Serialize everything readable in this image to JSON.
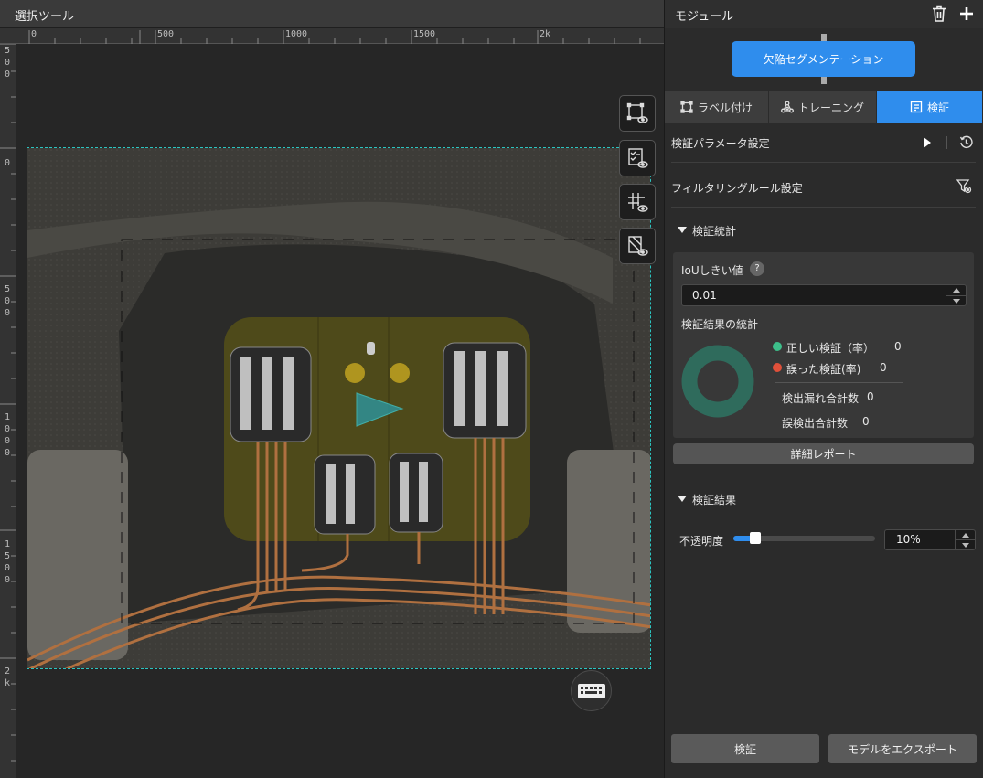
{
  "left_pane": {
    "title": "選択ツール",
    "ruler_top_labels": [
      "0",
      "500",
      "1000",
      "1500",
      "2k"
    ],
    "ruler_left_labels": [
      "5\n0\n0",
      "0",
      "5\n0\n0",
      "1\n0\n0\n0",
      "1\n5\n0\n0",
      "2\nk"
    ]
  },
  "tools": [
    {
      "icon": "roi-eye-icon"
    },
    {
      "icon": "checklist-eye-icon"
    },
    {
      "icon": "grid-eye-icon"
    },
    {
      "icon": "mask-eye-icon"
    }
  ],
  "keyboard_icon": "keyboard-icon",
  "right_pane": {
    "title": "モジュール",
    "module_name": "欠陥セグメンテーション",
    "tabs": [
      {
        "label": "ラベル付け",
        "icon": "label-icon",
        "active": false
      },
      {
        "label": "トレーニング",
        "icon": "training-icon",
        "active": false
      },
      {
        "label": "検証",
        "icon": "verify-icon",
        "active": true
      }
    ],
    "param_settings": "検証パラメータ設定",
    "filter_settings": "フィルタリングルール設定",
    "stats_section": "検証統計",
    "iou_label": "IoUしきい値",
    "iou_help": "?",
    "iou_value": "0.01",
    "stats_title": "検証結果の統計",
    "stats": {
      "correct_label": "正しい検証（率）",
      "correct_value": "0",
      "wrong_label": "誤った検証(率)",
      "wrong_value": "0",
      "missed_label": "検出漏れ合計数",
      "missed_value": "0",
      "false_label": "誤検出合計数",
      "false_value": "0"
    },
    "report_button": "詳細レポート",
    "results_section": "検証結果",
    "opacity_label": "不透明度",
    "opacity_value": "10%",
    "opacity_fraction": 0.1,
    "verify_button": "検証",
    "export_button": "モデルをエクスポート"
  },
  "colors": {
    "accent": "#2f8ded",
    "frame": "#2bc4c0",
    "correct": "#3dbf8a",
    "wrong": "#e0503a",
    "donut": "#2f6b5c"
  }
}
